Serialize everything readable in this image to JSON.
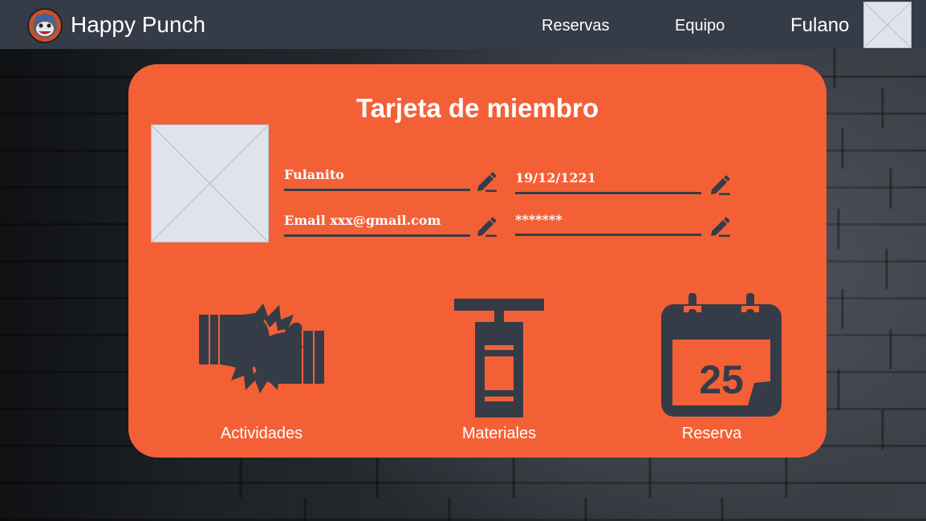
{
  "colors": {
    "topbar": "#353c47",
    "card": "#f46036",
    "dark": "#353c47",
    "placeholder": "#dfe4ec",
    "text": "#ffffff"
  },
  "header": {
    "brand": "Happy Punch",
    "nav": [
      {
        "label": "Reservas"
      },
      {
        "label": "Equipo"
      }
    ],
    "user_name": "Fulano",
    "logo_icon": "boxer-mascot-logo",
    "avatar_icon": "image-placeholder-icon"
  },
  "card": {
    "title": "Tarjeta de miembro",
    "photo_icon": "image-placeholder-icon",
    "fields": {
      "name": "Fulanito",
      "birthdate": "19/12/1221",
      "email": "Email xxx@gmail.com",
      "password": "*******"
    },
    "edit_icon": "pencil-icon",
    "features": [
      {
        "label": "Actividades",
        "icon": "boxing-gloves-icon"
      },
      {
        "label": "Materiales",
        "icon": "punching-bag-icon"
      },
      {
        "label": "Reserva",
        "icon": "calendar-icon",
        "icon_text": "25"
      }
    ]
  }
}
